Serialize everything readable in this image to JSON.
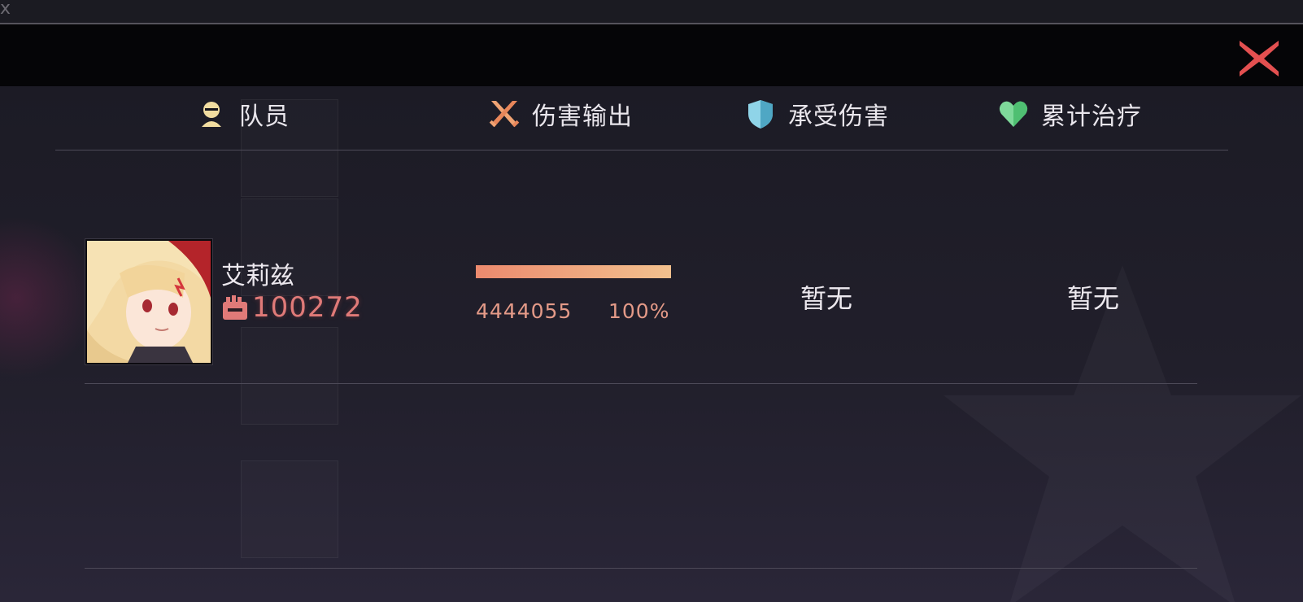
{
  "window": {
    "corner_glyph": "x",
    "close_icon": "close-icon",
    "accent_color": "#e35050"
  },
  "table": {
    "headers": [
      {
        "label": "队员",
        "icon": "member-icon",
        "icon_color": "#f1dca0"
      },
      {
        "label": "伤害输出",
        "icon": "crossed-swords-icon",
        "icon_color": "#f0a373"
      },
      {
        "label": "承受伤害",
        "icon": "shield-icon",
        "icon_color": "#8fd4e8"
      },
      {
        "label": "累计治疗",
        "icon": "heart-icon",
        "icon_color": "#7ed99a"
      }
    ],
    "rows": [
      {
        "name": "艾莉兹",
        "power_icon": "fist-icon",
        "power": "100272",
        "damage_dealt": "4444055",
        "damage_percent": "100%",
        "damage_fraction": 1.0,
        "damage_taken": "暂无",
        "healing": "暂无"
      }
    ]
  }
}
